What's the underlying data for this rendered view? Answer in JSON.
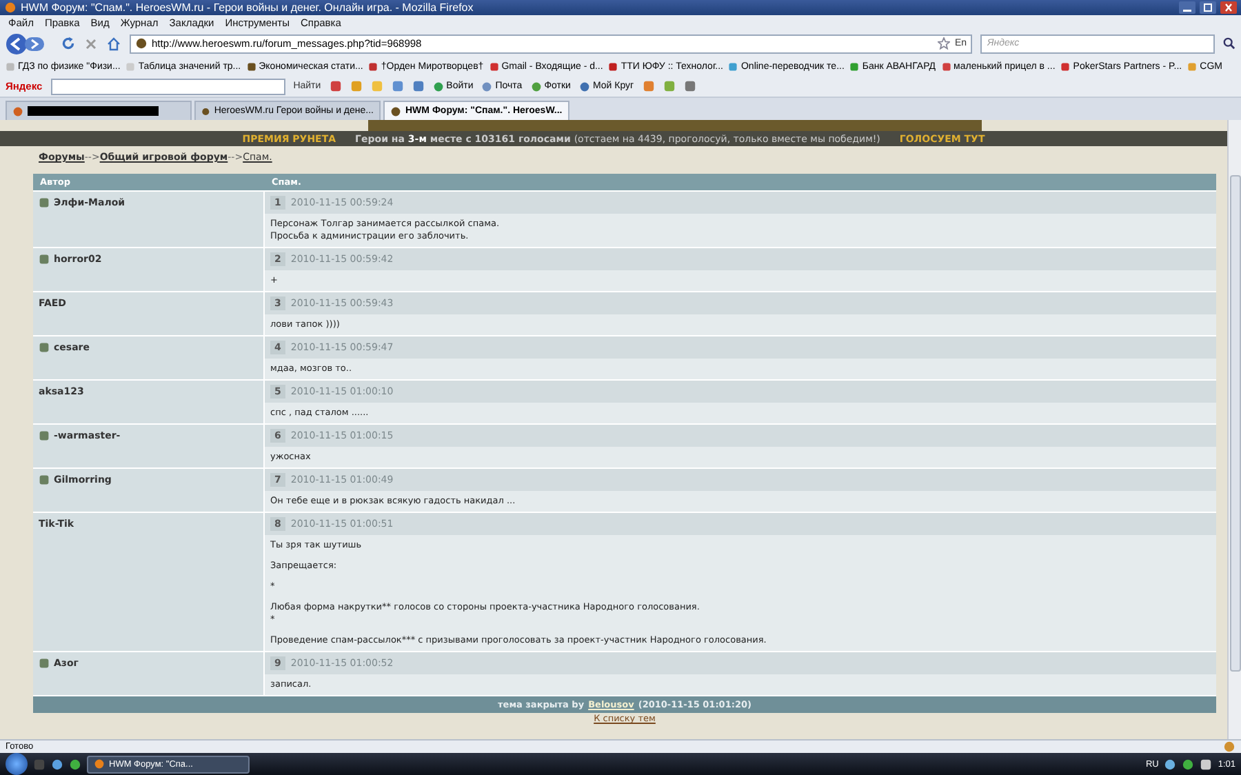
{
  "window": {
    "title": "HWM Форум: \"Спам.\". HeroesWM.ru - Герои войны и денег. Онлайн игра. - Mozilla Firefox"
  },
  "menu": [
    "Файл",
    "Правка",
    "Вид",
    "Журнал",
    "Закладки",
    "Инструменты",
    "Справка"
  ],
  "address": {
    "value": "http://www.heroeswm.ru/forum_messages.php?tid=968998",
    "lang": "En"
  },
  "search": {
    "placeholder": "Яндекс"
  },
  "bookmarks": [
    "ГДЗ по физике \"Физи...",
    "Таблица значений тр...",
    "Экономическая стати...",
    "†Орден Миротворцев†",
    "Gmail - Входящие - d...",
    "ТТИ ЮФУ :: Технолог...",
    "Online-переводчик те...",
    "Банк АВАНГАРД",
    "маленький прицел в ...",
    "PokerStars Partners - P...",
    "CGM"
  ],
  "yandex_bar": {
    "brand": "Яндекс",
    "find": "Найти",
    "items": [
      "Войти",
      "Почта",
      "Фотки",
      "Мой Круг"
    ]
  },
  "tabs": [
    {
      "redacted": true,
      "selected": false
    },
    {
      "label": "HeroesWM.ru Герои войны и дене...",
      "redacted": false,
      "selected": false
    },
    {
      "label": "HWM Форум: \"Спам.\". HeroesW...",
      "redacted": false,
      "selected": true
    }
  ],
  "banner": {
    "award": "ПРЕМИЯ РУНЕТА",
    "text": "Герои на **3-м** месте с 103161 голосами",
    "tail": "(отстаем на 4439, проголосуй, только вместе мы победим!)",
    "vote": "ГОЛОСУЕМ ТУТ"
  },
  "breadcrumb": {
    "separator": "-->",
    "items": [
      {
        "label": "Форумы",
        "bold": true
      },
      {
        "label": "Общий игровой форум",
        "bold": true
      },
      {
        "label": "Спам.",
        "bold": false
      }
    ]
  },
  "table": {
    "columns": [
      "Автор",
      "Спам."
    ],
    "posts": [
      {
        "author": "Элфи-Малой",
        "clan_icon": true,
        "number": "1",
        "date": "2010-11-15 00:59:24",
        "body": [
          "Персонаж Толгар занимается рассылкой спама.\nПросьба к администрации его заблочить."
        ]
      },
      {
        "author": "horror02",
        "clan_icon": true,
        "number": "2",
        "date": "2010-11-15 00:59:42",
        "body": [
          "+"
        ]
      },
      {
        "author": "FAED",
        "clan_icon": false,
        "number": "3",
        "date": "2010-11-15 00:59:43",
        "body": [
          "лови тапок ))))"
        ]
      },
      {
        "author": "cesare",
        "clan_icon": true,
        "number": "4",
        "date": "2010-11-15 00:59:47",
        "body": [
          "мдаа, мозгов то.."
        ]
      },
      {
        "author": "aksa123",
        "clan_icon": false,
        "number": "5",
        "date": "2010-11-15 01:00:10",
        "body": [
          "спс , пад сталом ......"
        ]
      },
      {
        "author": "-warmaster-",
        "clan_icon": true,
        "number": "6",
        "date": "2010-11-15 01:00:15",
        "body": [
          "ужоснах"
        ]
      },
      {
        "author": "Gilmorring",
        "clan_icon": true,
        "number": "7",
        "date": "2010-11-15 01:00:49",
        "body": [
          "Он тебе еще и в рюкзак всякую гадость накидал ..."
        ]
      },
      {
        "author": "Tik-Tik",
        "clan_icon": false,
        "number": "8",
        "date": "2010-11-15 01:00:51",
        "body": [
          "Ты зря так шутишь",
          "Запрещается:",
          "*",
          "Любая форма накрутки** голосов со стороны проекта-участника Народного голосования.\n*",
          "Проведение спам-рассылок*** с призывами проголосовать за проект-участник Народного голосования."
        ]
      },
      {
        "author": "Азог",
        "clan_icon": true,
        "number": "9",
        "date": "2010-11-15 01:00:52",
        "body": [
          "записал."
        ]
      }
    ],
    "closed": {
      "text": "тема закрыта by",
      "user": "Belousov",
      "date": "(2010-11-15 01:01:20)"
    }
  },
  "back_link": "К списку тем",
  "status_bar": "Готово",
  "taskbar": {
    "task": "HWM Форум: \"Спа...",
    "lang": "RU",
    "time": "1:01"
  }
}
